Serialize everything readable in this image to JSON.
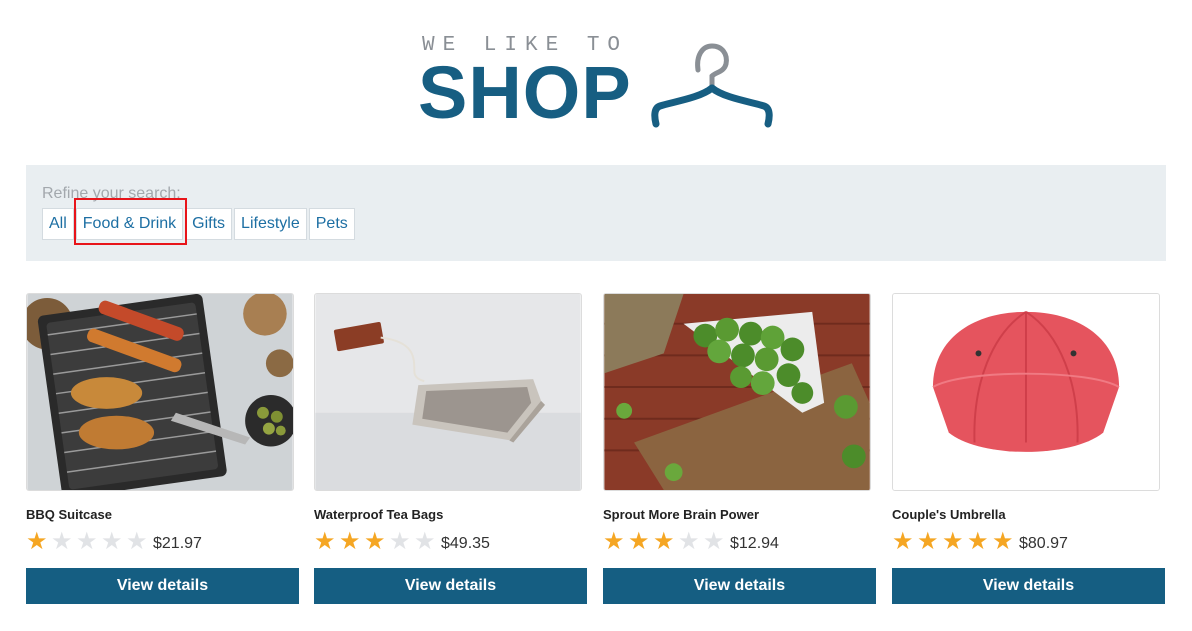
{
  "logo": {
    "tagline": "WE LIKE TO",
    "word": "SHOP",
    "brand_color": "#175e82"
  },
  "filters": {
    "label": "Refine your search:",
    "items": [
      "All",
      "Food & Drink",
      "Gifts",
      "Lifestyle",
      "Pets"
    ],
    "highlighted": "Food & Drink"
  },
  "products": [
    {
      "title": "BBQ Suitcase",
      "price": "$21.97",
      "rating": 1,
      "button": "View details",
      "image": "bbq-grill-image"
    },
    {
      "title": "Waterproof Tea Bags",
      "price": "$49.35",
      "rating": 3,
      "button": "View details",
      "image": "tea-bag-image"
    },
    {
      "title": "Sprout More Brain Power",
      "price": "$12.94",
      "rating": 3,
      "button": "View details",
      "image": "brussels-sprouts-image"
    },
    {
      "title": "Couple's Umbrella",
      "price": "$80.97",
      "rating": 5,
      "button": "View details",
      "image": "red-umbrella-image"
    }
  ],
  "colors": {
    "star_on": "#f5a623",
    "star_off": "#e1e3e6",
    "button_bg": "#155e82",
    "highlight": "#e8141a"
  }
}
